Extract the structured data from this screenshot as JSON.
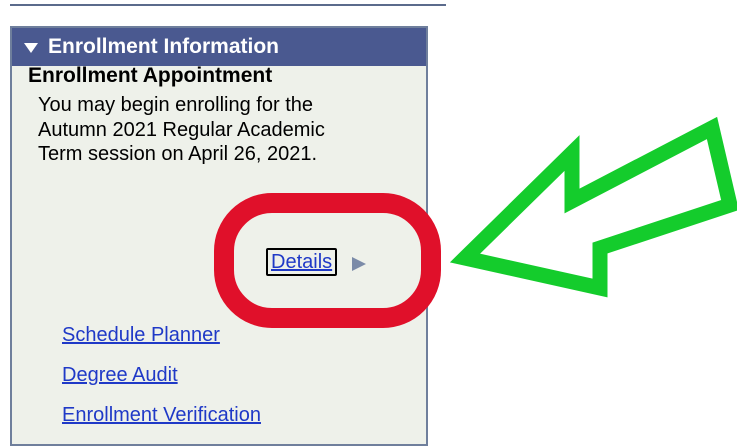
{
  "panel": {
    "header_title": "Enrollment Information",
    "section_title": "Enrollment Appointment",
    "message": "You may begin enrolling for the Autumn 2021 Regular Academic Term session on April 26, 2021.",
    "details_label": "Details"
  },
  "links": [
    {
      "label": "Schedule Planner"
    },
    {
      "label": "Degree Audit"
    },
    {
      "label": "Enrollment Verification"
    }
  ],
  "colors": {
    "header_background": "#4a5990",
    "panel_background": "#eef1ea",
    "link": "#1f39c7",
    "annotation_ring": "#e0102a",
    "annotation_arrow": "#14cc2c"
  },
  "icons": {
    "header_toggle": "triangle-down-icon",
    "details": "triangle-right-icon"
  }
}
